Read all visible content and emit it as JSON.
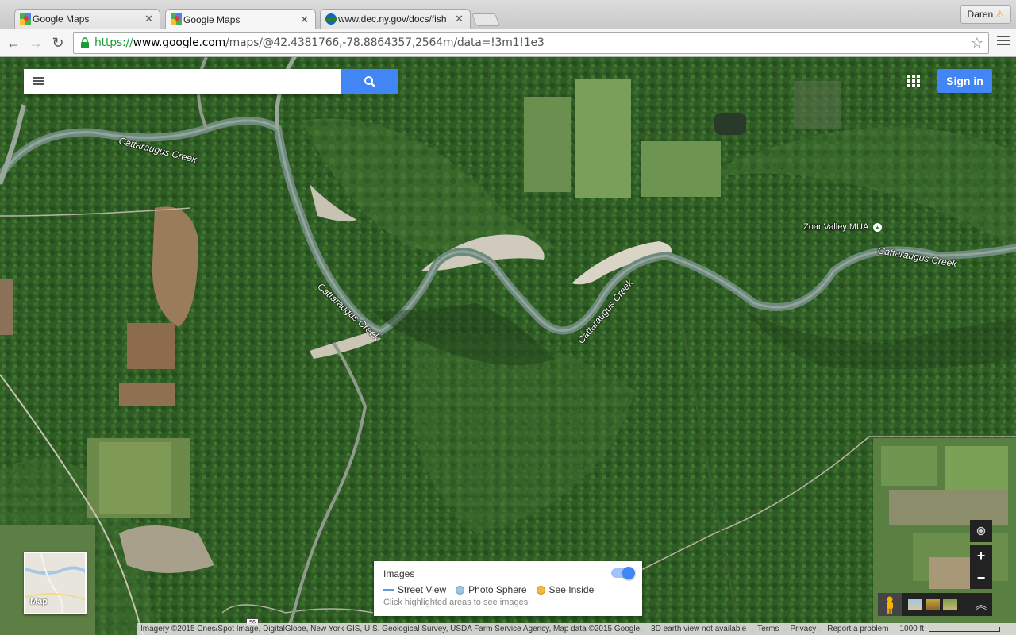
{
  "browser": {
    "tabs": [
      {
        "title": "Google Maps",
        "active": false
      },
      {
        "title": "Google Maps",
        "active": true
      },
      {
        "title": "www.dec.ny.gov/docs/fish",
        "active": false
      }
    ],
    "profile_name": "Daren",
    "profile_icon": "warning-icon",
    "url": {
      "scheme": "https://",
      "host": "www.google.com",
      "path": "/maps/@42.4381766,-78.8864357,2564m/data=!3m1!1e3"
    }
  },
  "map": {
    "search": {
      "value": "",
      "placeholder": ""
    },
    "signin_label": "Sign in",
    "labels": {
      "creek_1": "Cattaraugus Creek",
      "creek_2": "Cattaraugus Creek",
      "creek_3": "Cattaraugus Creek",
      "creek_4": "Cattaraugus Creek",
      "poi": "Zoar Valley MUA"
    },
    "road_shield": "56",
    "minimap_label": "Map",
    "images_panel": {
      "heading": "Images",
      "legend": [
        {
          "label": "Street View",
          "color": "#5c9dd6"
        },
        {
          "label": "Photo Sphere",
          "color": "#9fc5e0"
        },
        {
          "label": "See Inside",
          "color": "#f5b642"
        }
      ],
      "hint": "Click highlighted areas to see images",
      "toggle_on": true
    },
    "controls": {
      "zoom_in": "+",
      "zoom_out": "−"
    },
    "footer": {
      "imagery": "Imagery ©2015 Cnes/Spot Image, DigitalGlobe, New York GIS, U.S. Geological Survey, USDA Farm Service Agency, Map data ©2015 Google",
      "earth": "3D earth view not available",
      "terms": "Terms",
      "privacy": "Privacy",
      "report": "Report a problem",
      "scale": "1000 ft"
    }
  },
  "colors": {
    "accent": "#4285f4",
    "forest": "#2d5a24",
    "river": "#5f7a6e"
  }
}
